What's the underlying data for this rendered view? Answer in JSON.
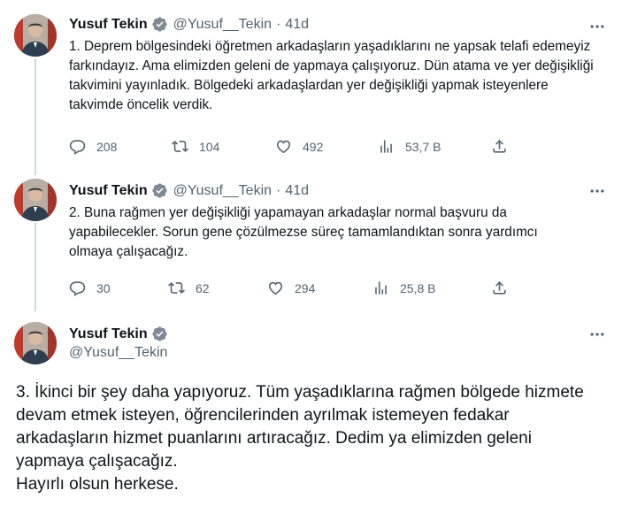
{
  "colors": {
    "accent": "#1d9bf0",
    "text": "#0f1419",
    "muted": "#536471",
    "line": "#cfd9de"
  },
  "tweets": [
    {
      "author": {
        "name": "Yusuf Tekin",
        "handle": "@Yusuf__Tekin",
        "verified": true
      },
      "separator": "·",
      "time": "41d",
      "text": "1. Deprem bölgesindeki öğretmen arkadaşların yaşadıklarını ne yapsak telafi edemeyiz farkındayız. Ama elimizden geleni de yapmaya çalışıyoruz. Dün atama ve yer değişikliği takvimini yayınladık. Bölgedeki arkadaşlardan yer değişikliği yapmak isteyenlere takvimde öncelik verdik.",
      "stats": {
        "replies": "208",
        "retweets": "104",
        "likes": "492",
        "views": "53,7 B"
      }
    },
    {
      "author": {
        "name": "Yusuf Tekin",
        "handle": "@Yusuf__Tekin",
        "verified": true
      },
      "separator": "·",
      "time": "41d",
      "text": "2. Buna rağmen yer değişikliği yapamayan arkadaşlar normal başvuru da yapabilecekler. Sorun gene çözülmezse süreç tamamlandıktan sonra yardımcı olmaya çalışacağız.",
      "stats": {
        "replies": "30",
        "retweets": "62",
        "likes": "294",
        "views": "25,8 B"
      }
    },
    {
      "author": {
        "name": "Yusuf Tekin",
        "handle": "@Yusuf__Tekin",
        "verified": true
      },
      "text": "3. İkinci bir şey daha yapıyoruz. Tüm yaşadıklarına rağmen bölgede hizmete devam etmek isteyen, öğrencilerinden ayrılmak istemeyen fedakar arkadaşların hizmet puanlarını artıracağız. Dedim ya elimizden geleni yapmaya çalışacağız.",
      "closing": "Hayırlı olsun herkese."
    }
  ]
}
